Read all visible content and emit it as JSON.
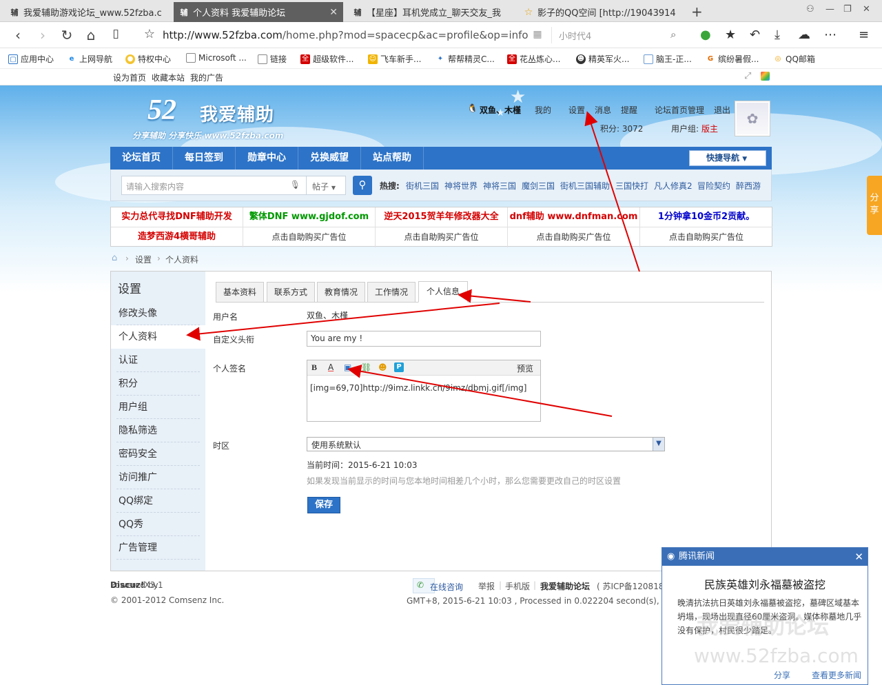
{
  "browser": {
    "tabs": [
      {
        "icon": "辅",
        "title": "我爱辅助游戏论坛_www.52fzba.c"
      },
      {
        "icon": "辅",
        "title": "个人资料 我爱辅助论坛",
        "active": true
      },
      {
        "icon": "辅",
        "title": "【星座】耳机党成立_聊天交友_我"
      },
      {
        "icon": "☆",
        "title": "影子的QQ空间 [http://19043914"
      }
    ],
    "url_host": "http://www.52fzba.com",
    "url_path": "/home.php?mod=spacecp&ac=profile&op=info",
    "search_placeholder": "小时代4",
    "bookmarks": [
      "应用中心",
      "上网导航",
      "特权中心",
      "Microsoft ...",
      "链接",
      "超级软件...",
      "飞车新手...",
      "帮帮精灵C...",
      "花丛炼心...",
      "精英军火...",
      "脑王-正...",
      "缤纷暑假...",
      "QQ邮箱"
    ]
  },
  "site_top": {
    "links": [
      "设为首页",
      "收藏本站",
      "我的广告"
    ]
  },
  "header": {
    "logo_num": "52",
    "logo_name": "我爱辅助",
    "logo_slogan": "分享辅助  分享快乐  www.52fzba.com",
    "username": "双鱼、木槿",
    "links": [
      "我的",
      "设置",
      "消息",
      "提醒",
      "论坛首页管理",
      "退出"
    ],
    "points_label": "积分: 3072",
    "usergroup_label": "用户组:",
    "usergroup_value": "版主"
  },
  "mainnav": {
    "items": [
      "论坛首页",
      "每日签到",
      "勋章中心",
      "兑换威望",
      "站点帮助"
    ],
    "quick": "快捷导航"
  },
  "search": {
    "placeholder": "请输入搜索内容",
    "type": "帖子",
    "hot_label": "热搜:",
    "hot": [
      "街机三国",
      "神将世界",
      "神将三国",
      "魔剑三国",
      "街机三国辅助",
      "三国快打",
      "凡人修真2",
      "冒险契约",
      "醉西游"
    ]
  },
  "ads": {
    "row1": [
      {
        "text": "实力总代寻找DNF辅助开发",
        "color": "#d40000"
      },
      {
        "text": "繁体DNF www.gjdof.com",
        "color": "#009900"
      },
      {
        "text": "逆天2015贺羊年修改器大全",
        "color": "#d40000"
      },
      {
        "text": "dnf辅助 www.dnfman.com",
        "color": "#d40000"
      },
      {
        "text": "1分钟拿10金币2贡献。",
        "color": "#0000cc"
      }
    ],
    "row2": [
      {
        "text": "造梦西游4横哥辅助",
        "color": "#d40000"
      },
      {
        "text": "点击自助购买广告位",
        "color": "#333333"
      },
      {
        "text": "点击自助购买广告位",
        "color": "#333333"
      },
      {
        "text": "点击自助购买广告位",
        "color": "#333333"
      },
      {
        "text": "点击自助购买广告位",
        "color": "#333333"
      }
    ]
  },
  "breadcrumb": [
    "设置",
    "个人资料"
  ],
  "sidebar": {
    "title": "设置",
    "items": [
      "修改头像",
      "个人资料",
      "认证",
      "积分",
      "用户组",
      "隐私筛选",
      "密码安全",
      "访问推广",
      "QQ绑定",
      "QQ秀",
      "广告管理"
    ]
  },
  "profile_tabs": [
    "基本资料",
    "联系方式",
    "教育情况",
    "工作情况",
    "个人信息"
  ],
  "form": {
    "username_label": "用户名",
    "username_value": "双鱼、木槿",
    "title_label": "自定义头衔",
    "title_value": "You are my !",
    "sig_label": "个人签名",
    "sig_preview": "预览",
    "sig_value": "[img=69,70]http://9imz.linkk.cn/9imz/dbmj.gif[/img]",
    "tz_label": "时区",
    "tz_value": "使用系统默认",
    "current_time": "当前时间：2015-6-21 10:03",
    "tz_hint": "如果发现当前显示的时间与您本地时间相差几个小时，那么您需要更改自己的时区设置",
    "save": "保存"
  },
  "footer": {
    "powered": "Powered by",
    "brand": "Discuz!",
    "version": "X3.1",
    "copy": "© 2001-2012 Comsenz Inc.",
    "consult": "在线咨询",
    "links": [
      "举报",
      "手机版",
      "我爱辅助论坛"
    ],
    "icp": "( 苏ICP备1208188",
    "timeinfo": "GMT+8, 2015-6-21 10:03 , Processed in 0.022204 second(s), 2 que"
  },
  "share_tab": "分享",
  "news_popup": {
    "header": "腾讯新闻",
    "title": "民族英雄刘永福墓被盗挖",
    "text": "晚清抗法抗日英雄刘永福墓被盗挖，墓碑区域基本坍塌，现场出现直径60厘米盗洞。媒体称墓地几乎没有保护，村民很少踏足。",
    "watermark1": "我爱辅助论坛",
    "watermark2": "www.52fzba.com",
    "share": "分享",
    "more": "查看更多新闻"
  }
}
